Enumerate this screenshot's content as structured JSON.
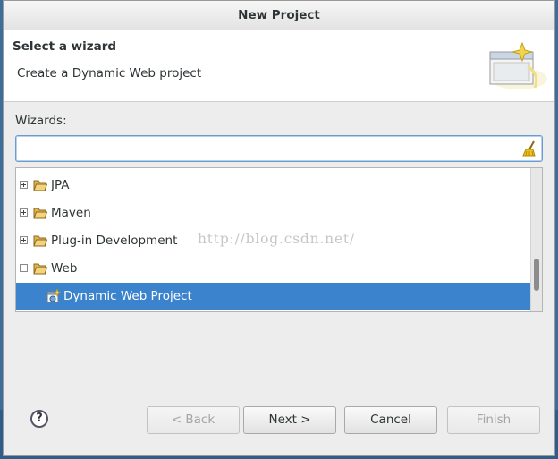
{
  "dialog": {
    "title": "New Project"
  },
  "banner": {
    "title": "Select a wizard",
    "description": "Create a Dynamic Web project"
  },
  "wizards": {
    "label": "Wizards:",
    "filter_value": "",
    "tree": [
      {
        "label": "JPA",
        "expanded": false,
        "type": "folder"
      },
      {
        "label": "Maven",
        "expanded": false,
        "type": "folder"
      },
      {
        "label": "Plug-in Development",
        "expanded": false,
        "type": "folder"
      },
      {
        "label": "Web",
        "expanded": true,
        "type": "folder"
      },
      {
        "label": "Dynamic Web Project",
        "type": "wizard",
        "selected": true
      }
    ]
  },
  "watermark": "http://blog.csdn.net/",
  "buttons": {
    "help": "?",
    "back": "< Back",
    "next": "Next >",
    "cancel": "Cancel",
    "finish": "Finish"
  },
  "colors": {
    "selection": "#3b83cc",
    "filter_border": "#6a9bd1"
  }
}
